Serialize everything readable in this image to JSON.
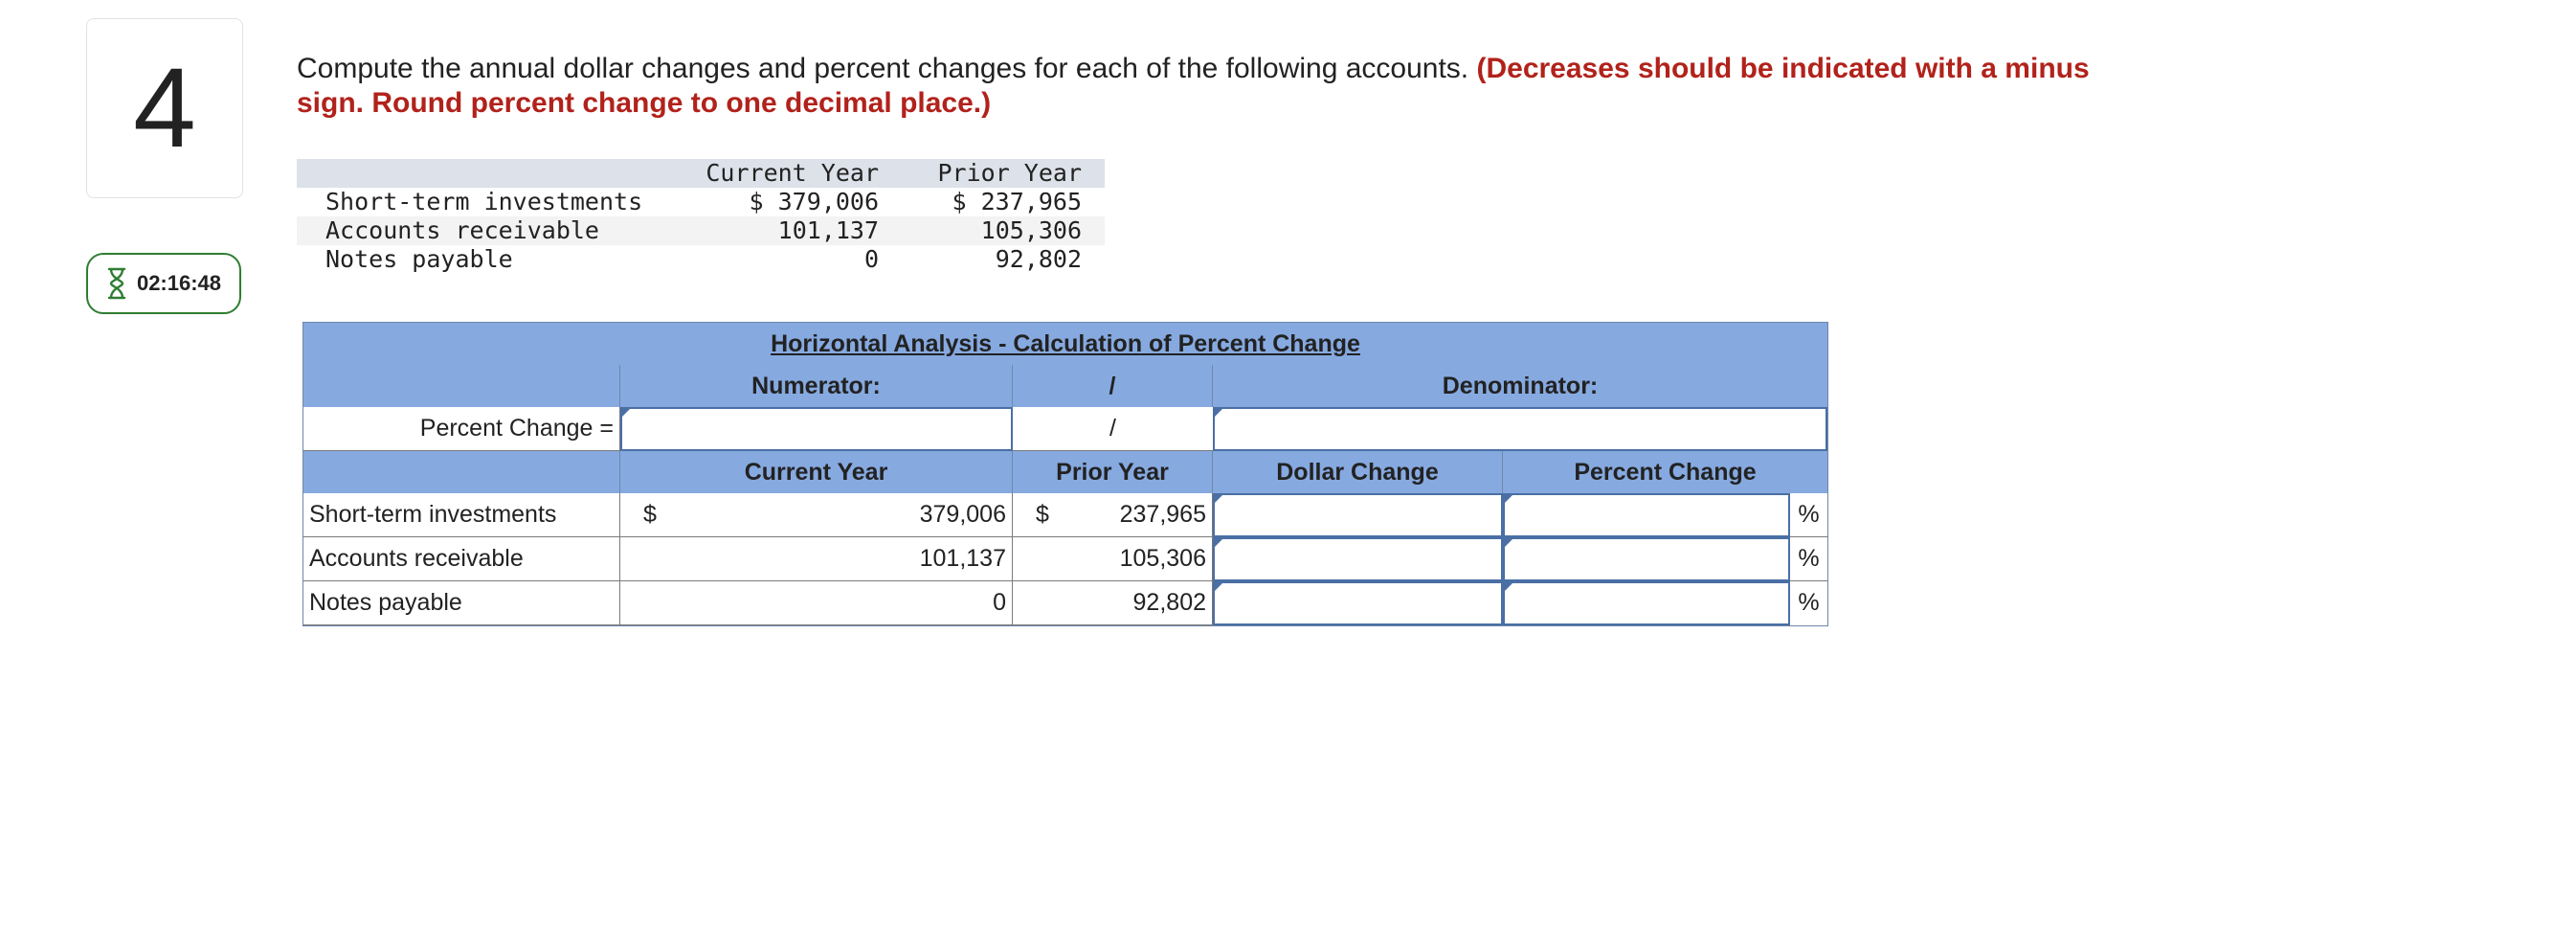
{
  "question_number": "4",
  "timer": {
    "icon": "hourglass-icon",
    "time": "02:16:48"
  },
  "instructions": {
    "text": "Compute the annual dollar changes and percent changes for each of the following accounts.",
    "emphasis": "(Decreases should be indicated with a minus sign. Round percent change to one decimal place.)"
  },
  "given_data": {
    "headers": {
      "current_year": "Current Year",
      "prior_year": "Prior Year"
    },
    "rows": [
      {
        "label": "Short-term investments",
        "current_year": "$ 379,006",
        "prior_year": "$ 237,965"
      },
      {
        "label": "Accounts receivable",
        "current_year": "101,137",
        "prior_year": "105,306"
      },
      {
        "label": "Notes payable",
        "current_year": "0",
        "prior_year": "92,802"
      }
    ]
  },
  "analysis_table": {
    "title": "Horizontal Analysis - Calculation of Percent Change",
    "numerator_label": "Numerator:",
    "divider": "/",
    "denominator_label": "Denominator:",
    "percent_change_label": "Percent Change =",
    "numerator_value": "",
    "denominator_value": "",
    "columns": {
      "current_year": "Current Year",
      "prior_year": "Prior Year",
      "dollar_change": "Dollar Change",
      "percent_change": "Percent Change"
    },
    "currency_symbol": "$",
    "percent_symbol": "%",
    "rows": [
      {
        "label": "Short-term investments",
        "current_year": "379,006",
        "prior_year": "237,965",
        "dollar_change": "",
        "percent_change": ""
      },
      {
        "label": "Accounts receivable",
        "current_year": "101,137",
        "prior_year": "105,306",
        "dollar_change": "",
        "percent_change": ""
      },
      {
        "label": "Notes payable",
        "current_year": "0",
        "prior_year": "92,802",
        "dollar_change": "",
        "percent_change": ""
      }
    ]
  },
  "colors": {
    "header_blue": "#86a9e0",
    "emphasis_red": "#b1221b",
    "timer_green": "#2f7d32",
    "input_border": "#4a6fa5"
  }
}
